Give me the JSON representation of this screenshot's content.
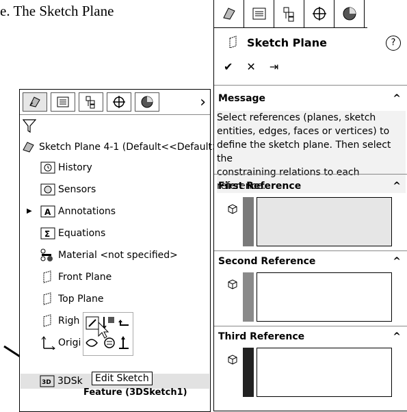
{
  "document": {
    "text": "e. The Sketch Plane"
  },
  "feature_manager": {
    "tabs": [
      "feature-manager-icon",
      "property-manager-icon",
      "configuration-manager-icon",
      "dimxpert-icon",
      "display-manager-icon"
    ],
    "root": "Sketch Plane 4-1  (Default<<Default>",
    "items": [
      {
        "label": "History",
        "icon": "history-icon"
      },
      {
        "label": "Sensors",
        "icon": "sensors-icon"
      },
      {
        "label": "Annotations",
        "icon": "annotations-icon"
      },
      {
        "label": "Equations",
        "icon": "equations-icon"
      },
      {
        "label": "Material <not specified>",
        "icon": "material-icon"
      },
      {
        "label": "Front Plane",
        "icon": "plane-icon"
      },
      {
        "label": "Top Plane",
        "icon": "plane-icon"
      },
      {
        "label": "Righ",
        "icon": "plane-icon"
      },
      {
        "label": "Origi",
        "icon": "origin-icon"
      },
      {
        "label": "3DSk",
        "icon": "sketch3d-icon"
      }
    ],
    "tooltip": "Edit Sketch",
    "tooltip_sub": "Feature (3DSketch1)"
  },
  "property_manager": {
    "title": "Sketch Plane",
    "help": "?",
    "actions": [
      "✔",
      "✕",
      "⇥"
    ],
    "message_header": "Message",
    "message_lines": [
      "Select references (planes, sketch",
      "entities, edges, faces or vertices) to",
      "define the sketch plane. Then select the",
      "constraining relations to each reference."
    ],
    "sections": [
      {
        "label": "First Reference",
        "color": "#7a7a7a",
        "filled": "#e6e6e6"
      },
      {
        "label": "Second Reference",
        "color": "#8a8a8a",
        "filled": "#ffffff"
      },
      {
        "label": "Third Reference",
        "color": "#222222",
        "filled": "#ffffff"
      }
    ]
  }
}
